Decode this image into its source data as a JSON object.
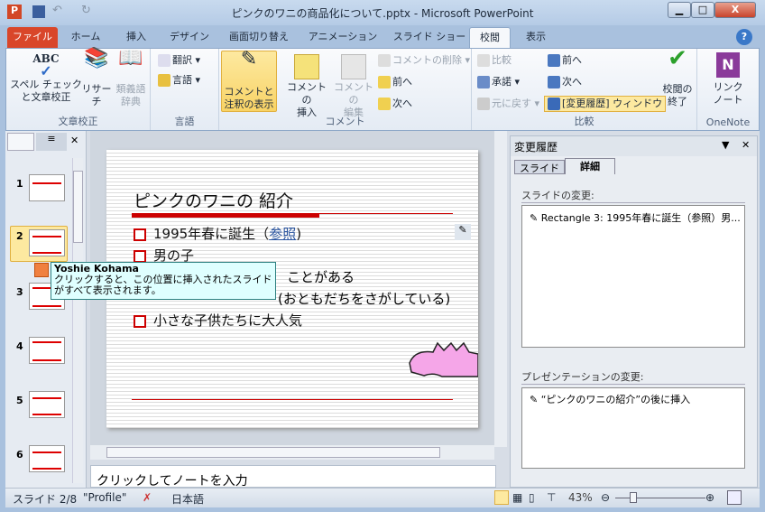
{
  "window": {
    "title": "ピンクのワニの商品化について.pptx - Microsoft PowerPoint",
    "minimize": "▁",
    "maximize": "□",
    "close": "X"
  },
  "tabs": [
    "ファイル",
    "ホーム",
    "挿入",
    "デザイン",
    "画面切り替え",
    "アニメーション",
    "スライド ショー",
    "校閲",
    "表示"
  ],
  "ribbon": {
    "proofing": {
      "label": "文章校正",
      "spell": "スペル チェック",
      "spell2": "と文章校正",
      "research": "リサーチ",
      "thesaurus": "類義語",
      "thesaurus2": "辞典"
    },
    "language": {
      "label": "言語",
      "translate": "翻訳",
      "language": "言語"
    },
    "comments": {
      "label": "コメント",
      "show": "コメントと",
      "show2": "注釈の表示",
      "insert": "コメントの",
      "insert2": "挿入",
      "edit": "コメントの",
      "edit2": "編集",
      "delete": "コメントの削除",
      "prev": "前へ",
      "next": "次へ"
    },
    "compare": {
      "label": "比較",
      "compare": "比較",
      "accept": "承諾",
      "reject": "元に戻す",
      "prev": "前へ",
      "next": "次へ",
      "pane": "[変更履歴] ウィンドウ",
      "end": "校閲の",
      "end2": "終了"
    },
    "onenote": {
      "label": "OneNote",
      "link": "リンク",
      "link2": "ノート"
    }
  },
  "slides": [
    "1",
    "2",
    "3",
    "4",
    "5",
    "6"
  ],
  "slide": {
    "title": "ピンクのワニの 紹介",
    "bullets": [
      "1995年春に誕生（",
      "男の子",
      "ことがある",
      "(おともだちをさがしている)",
      "小さな子供たちに大人気"
    ],
    "link": "参照",
    "close_paren": ")"
  },
  "tooltip": {
    "author": "Yoshie Kohama",
    "text": "クリックすると、この位置に挿入されたスライドがすべて表示されます。"
  },
  "notes": {
    "placeholder": "クリックしてノートを入力"
  },
  "revisions": {
    "title": "変更履歴",
    "tabs": [
      "スライド",
      "詳細"
    ],
    "active_tab": "詳細",
    "slide_changes_label": "スライドの変更:",
    "slide_changes": [
      "Rectangle 3: 1995年春に誕生（参照）男..."
    ],
    "presentation_changes_label": "プレゼンテーションの変更:",
    "presentation_changes": [
      "“ピンクのワニの紹介”の後に挿入"
    ]
  },
  "status": {
    "slide": "スライド 2/8",
    "theme": "\"Profile\"",
    "language": "日本語",
    "zoom": "43%",
    "zoom_value": 43
  },
  "colors": {
    "file_tab": "#d9462a",
    "accent_red": "#cc0000",
    "tooltip_bg": "#dfffff",
    "pink": "#f5a6e8"
  }
}
